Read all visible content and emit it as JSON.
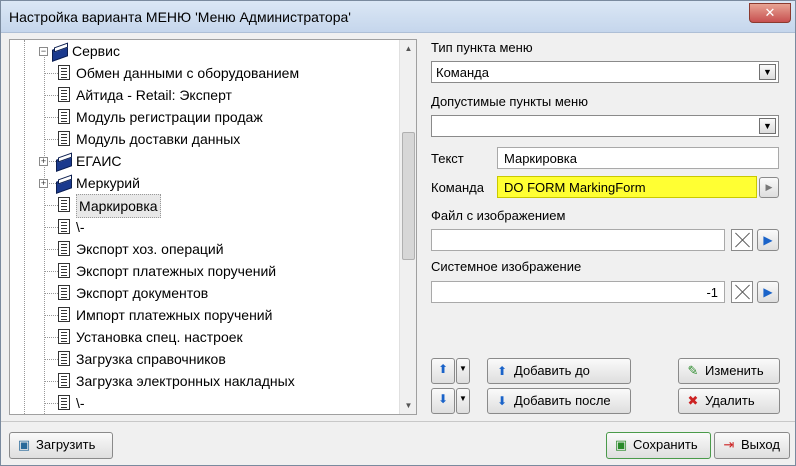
{
  "window": {
    "title": "Настройка варианта МЕНЮ 'Меню Администратора'",
    "close": "✕"
  },
  "tree": {
    "root": "Сервис",
    "items": [
      "Обмен данными с оборудованием",
      "Айтида - Retail: Эксперт",
      "Модуль регистрации продаж",
      "Модуль доставки данных",
      "ЕГАИС",
      "Меркурий",
      "Маркировка",
      "\\-",
      "Экспорт хоз. операций",
      "Экспорт платежных поручений",
      "Экспорт документов",
      "Импорт платежных поручений",
      "Установка спец. настроек",
      "Загрузка справочников",
      "Загрузка электронных накладных",
      "\\-"
    ]
  },
  "form": {
    "type_label": "Тип пункта меню",
    "type_value": "Команда",
    "allowed_label": "Допустимые пункты меню",
    "allowed_value": "",
    "text_label": "Текст",
    "text_value": "Маркировка",
    "command_label": "Команда",
    "command_value": "DO FORM MarkingForm",
    "image_file_label": "Файл с изображением",
    "image_file_value": "",
    "system_image_label": "Системное изображение",
    "system_image_value": "-1"
  },
  "buttons": {
    "add_before": "Добавить до",
    "add_after": "Добавить после",
    "edit": "Изменить",
    "delete": "Удалить",
    "load": "Загрузить",
    "save": "Сохранить",
    "exit": "Выход"
  },
  "colors": {
    "command_highlight": "#ffff33",
    "accent_blue": "#1a63c9",
    "delete_red": "#cc2222",
    "save_green": "#2a8a2a"
  }
}
